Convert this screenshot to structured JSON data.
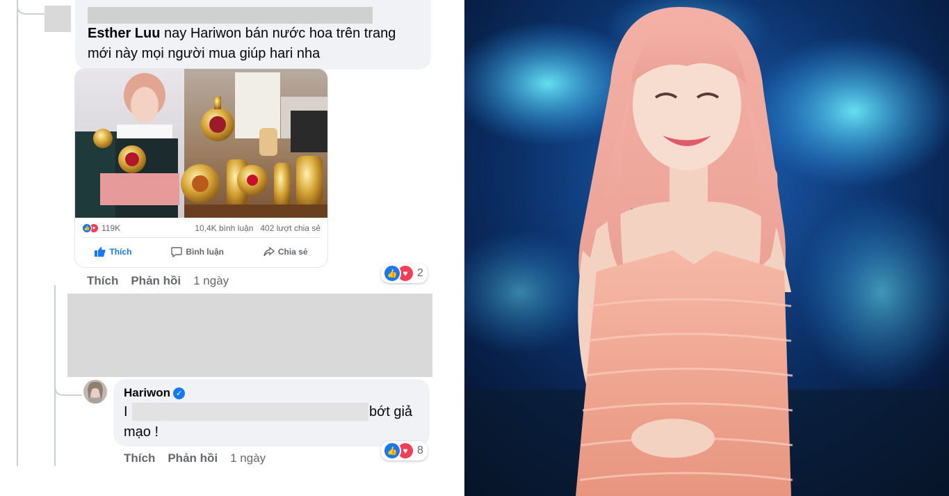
{
  "comment1": {
    "author": "Esther Luu",
    "text_line1": "nay Hariwon bán nước hoa trên trang",
    "text_line2": "mới này mọi người mua giúp hari nha",
    "actions": {
      "like": "Thích",
      "reply": "Phản hồi",
      "time": "1 ngày"
    },
    "reaction_count": "2",
    "shared_post": {
      "reaction_count": "119K",
      "comments": "10,4K bình luận",
      "shares": "402 lượt chia sẻ",
      "like_label": "Thích",
      "comment_label": "Bình luận",
      "share_label": "Chia sẻ"
    }
  },
  "comment2": {
    "author": "Hariwon",
    "text_start": "I",
    "text_end": "bớt giả",
    "text_line2": "mạo !",
    "actions": {
      "like": "Thích",
      "reply": "Phản hồi",
      "time": "1 ngày"
    },
    "reaction_count": "8"
  },
  "colors": {
    "bubble": "#f0f2f5",
    "like": "#1877f2",
    "love": "#f33e58",
    "redact": "#d9d9d9"
  },
  "icons": [
    "like-icon",
    "love-icon",
    "comment-icon",
    "share-icon",
    "verified-badge-icon"
  ]
}
